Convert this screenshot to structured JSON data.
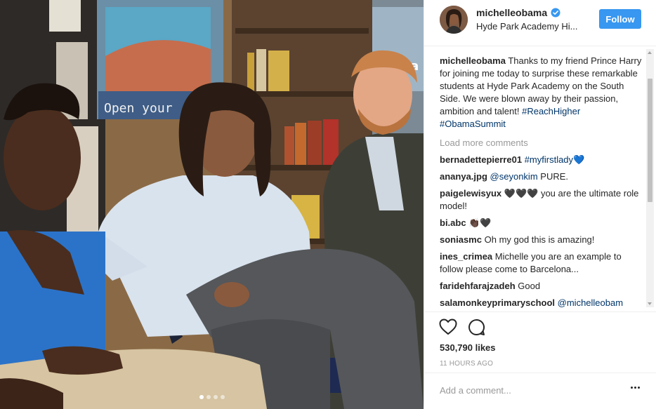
{
  "post": {
    "username": "michelleobama",
    "location": "Hyde Park Academy Hi...",
    "follow_label": "Follow",
    "caption_text": "Thanks to my friend Prince Harry for joining me today to surprise these remarkable students at Hyde Park Academy on the South Side. We were blown away by their passion, ambition and talent!",
    "hashtag_1": "#ReachHigher",
    "hashtag_2": "#ObamaSummit",
    "load_more": "Load more comments",
    "likes": "530,790 likes",
    "timestamp": "11 HOURS AGO",
    "add_comment_placeholder": "Add a comment..."
  },
  "photo": {
    "wall_sign_text": "Open your",
    "banner_text": "Rea"
  },
  "comments": [
    {
      "user": "bernadettepierre01",
      "text": "#myfirstlady",
      "suffix": "💙"
    },
    {
      "user": "ananya.jpg",
      "mention": "@seyonkim",
      "text": "PURE."
    },
    {
      "user": "paigelewisyux",
      "text": "🖤🖤🖤 you are the ultimate role model!"
    },
    {
      "user": "bi.abc",
      "text": "👏🏿🖤"
    },
    {
      "user": "soniasmc",
      "text": "Oh my god this is amazing!"
    },
    {
      "user": "ines_crimea",
      "text": "Michelle you are an example to follow please come to Barcelona..."
    },
    {
      "user": "faridehfarajzadeh",
      "text": "Good"
    },
    {
      "user": "salamonkeyprimaryschool",
      "mention": "@michelleobam"
    }
  ],
  "icons": {
    "verified": "verified-badge-icon",
    "like": "heart-icon",
    "comment": "comment-bubble-icon",
    "more": "more-options-icon"
  },
  "colors": {
    "follow_bg": "#3897f0",
    "link": "#003569",
    "muted": "#999999",
    "verified": "#3897f0"
  }
}
